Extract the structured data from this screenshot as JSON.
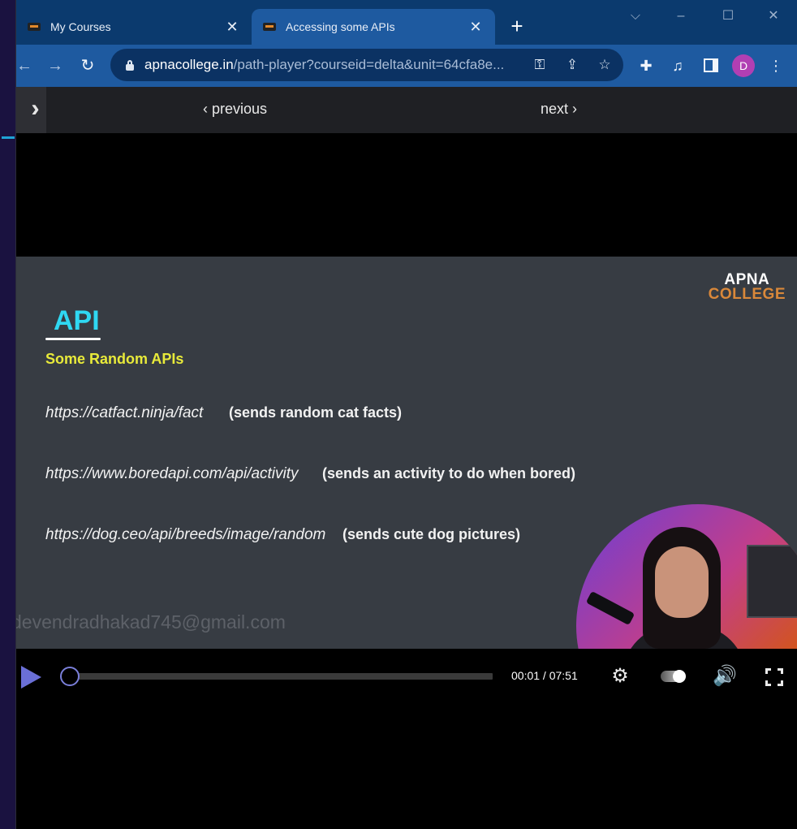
{
  "browser": {
    "tabs": [
      {
        "title": "My Courses",
        "active": false
      },
      {
        "title": "Accessing some APIs",
        "active": true
      }
    ],
    "url": {
      "domain": "apnacollege.in",
      "path": "/path-player?courseid=delta&unit=64cfa8e..."
    },
    "profile_initial": "D",
    "profile_color": "#b13fb3"
  },
  "lesson_nav": {
    "previous_label": "previous",
    "next_label": "next"
  },
  "slide": {
    "brand_line1": "APNA",
    "brand_line2": "COLLEGE",
    "title": "API",
    "subtitle": "Some Random APIs",
    "apis": [
      {
        "url": "https://catfact.ninja/fact",
        "description": "(sends random cat facts)"
      },
      {
        "url": "https://www.boredapi.com/api/activity",
        "description": "(sends an activity to do when bored)"
      },
      {
        "url": "https://dog.ceo/api/breeds/image/random",
        "description": "(sends cute dog pictures)"
      }
    ],
    "watermark": "devendradhakad745@gmail.com"
  },
  "player": {
    "time_display": "00:01 / 07:51",
    "progress_fraction": 0.002,
    "accent_color": "#7a7fd9"
  }
}
